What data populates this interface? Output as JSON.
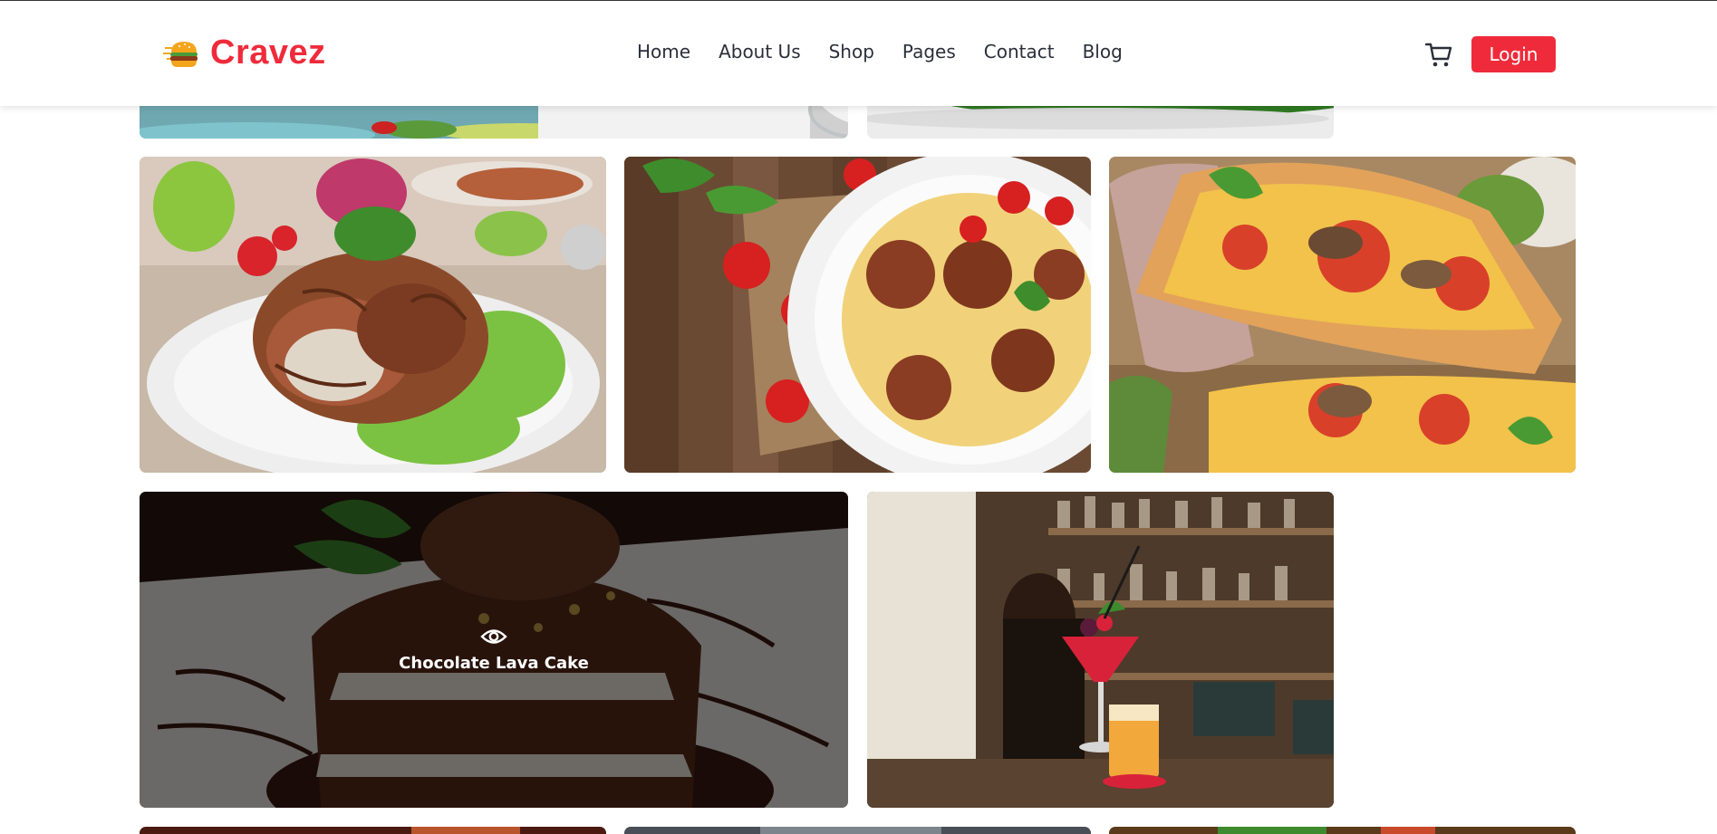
{
  "brand": {
    "name": "Cravez",
    "icon": "burger-icon",
    "color": "#ef2b3b"
  },
  "nav": {
    "items": [
      "Home",
      "About Us",
      "Shop",
      "Pages",
      "Contact",
      "Blog"
    ]
  },
  "header": {
    "cart_icon": "cart-icon",
    "login_label": "Login"
  },
  "gallery": {
    "items": [
      {
        "image": "salad-plate"
      },
      {
        "image": "greens-dish"
      },
      {
        "image": "thai-salad"
      },
      {
        "image": "meatball-pasta"
      },
      {
        "image": "pizza-slice"
      },
      {
        "image": "chocolate-lava-cake",
        "caption": "Chocolate Lava Cake",
        "icon": "eye-icon"
      },
      {
        "image": "cocktail-bar"
      },
      {
        "image": "partial-row-1"
      },
      {
        "image": "partial-row-2"
      },
      {
        "image": "partial-row-3"
      }
    ]
  },
  "colors": {
    "accent": "#ef2b3b",
    "text": "#2b2f3a"
  }
}
